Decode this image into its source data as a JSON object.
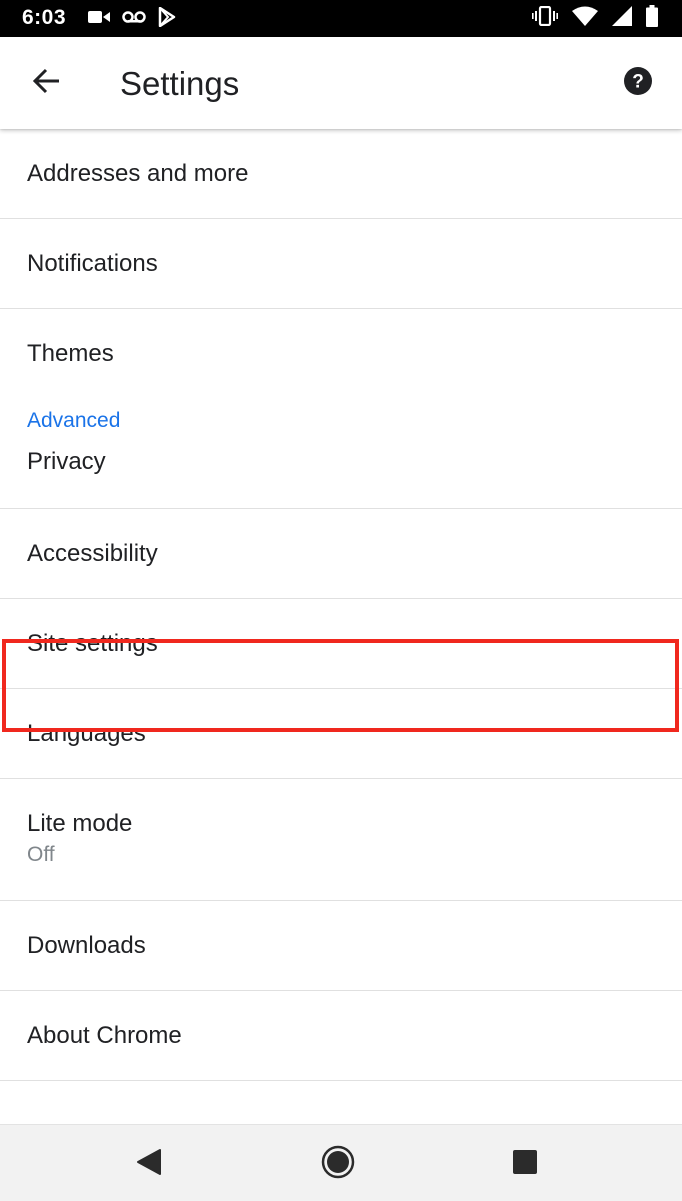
{
  "status_bar": {
    "time": "6:03",
    "left_icons": [
      "video-camera-icon",
      "voicemail-icon",
      "play-store-icon"
    ],
    "right_icons": [
      "vibrate-icon",
      "wifi-icon",
      "cell-signal-icon",
      "battery-icon"
    ]
  },
  "app_bar": {
    "title": "Settings",
    "back_icon": "arrow-back-icon",
    "help_icon": "help-icon"
  },
  "settings": {
    "addresses": "Addresses and more",
    "notifications": "Notifications",
    "themes": "Themes",
    "advanced_header": "Advanced",
    "privacy": "Privacy",
    "accessibility": "Accessibility",
    "site_settings": "Site settings",
    "languages": "Languages",
    "lite_mode": "Lite mode",
    "lite_mode_status": "Off",
    "downloads": "Downloads",
    "about_chrome": "About Chrome"
  },
  "highlight": {
    "target": "Site settings",
    "color": "#f0281e"
  },
  "colors": {
    "accent": "#1a73e8",
    "text": "#202124",
    "secondary_text": "#80868b"
  },
  "nav_bar": {
    "buttons": [
      "back-triangle-icon",
      "home-circle-icon",
      "recents-square-icon"
    ]
  }
}
